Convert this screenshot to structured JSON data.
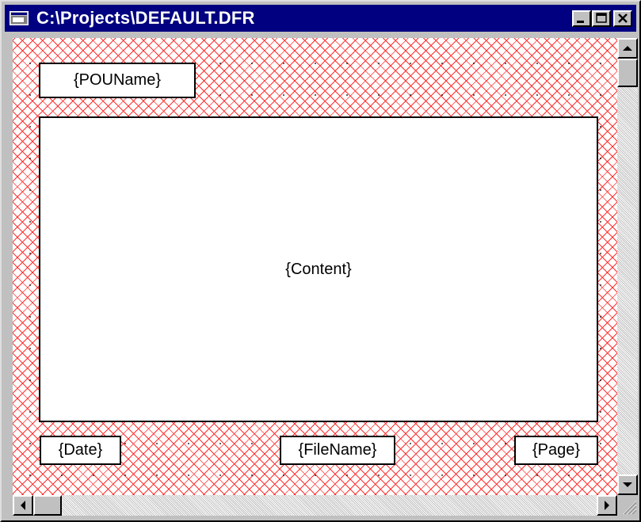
{
  "window": {
    "title": "C:\\Projects\\DEFAULT.DFR",
    "icon": "document-window-icon",
    "controls": [
      "minimize-button",
      "maximize-button",
      "close-button"
    ]
  },
  "canvas": {
    "pattern_color": "#ff3030",
    "fields": {
      "pou_name": "{POUName}",
      "content": "{Content}",
      "date": "{Date}",
      "file_name": "{FileName}",
      "page": "{Page}"
    }
  },
  "colors": {
    "titlebar": "#000080",
    "chrome": "#c0c0c0"
  }
}
